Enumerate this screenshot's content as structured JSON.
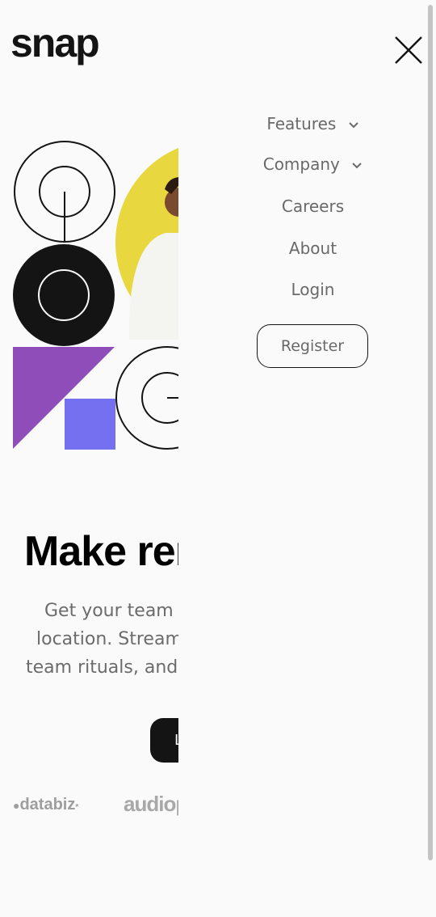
{
  "brand": {
    "logo_text": "snap"
  },
  "icons": {
    "close": "close-icon",
    "chevron": "chevron-down-icon"
  },
  "nav": {
    "items": [
      {
        "label": "Features",
        "has_dropdown": true
      },
      {
        "label": "Company",
        "has_dropdown": true
      },
      {
        "label": "Careers",
        "has_dropdown": false
      },
      {
        "label": "About",
        "has_dropdown": false
      },
      {
        "label": "Login",
        "has_dropdown": false
      }
    ],
    "register_label": "Register"
  },
  "hero": {
    "title": "Make remote work",
    "description_lines": [
      "Get your team in sync, no matter your",
      "location. Streamline processes, create",
      "team rituals, and watch productivity soar."
    ],
    "cta_label": "Learn more"
  },
  "clients": [
    {
      "name": "databiz",
      "logo_text": "databiz"
    },
    {
      "name": "audiophile",
      "logo_text": "audiophile"
    }
  ],
  "colors": {
    "background": "#fafafa",
    "text_dark": "#141414",
    "nav_text": "#696969",
    "accent_yellow": "#e8d73f",
    "accent_purple": "#8f4db9",
    "accent_blue": "#7570f0"
  }
}
